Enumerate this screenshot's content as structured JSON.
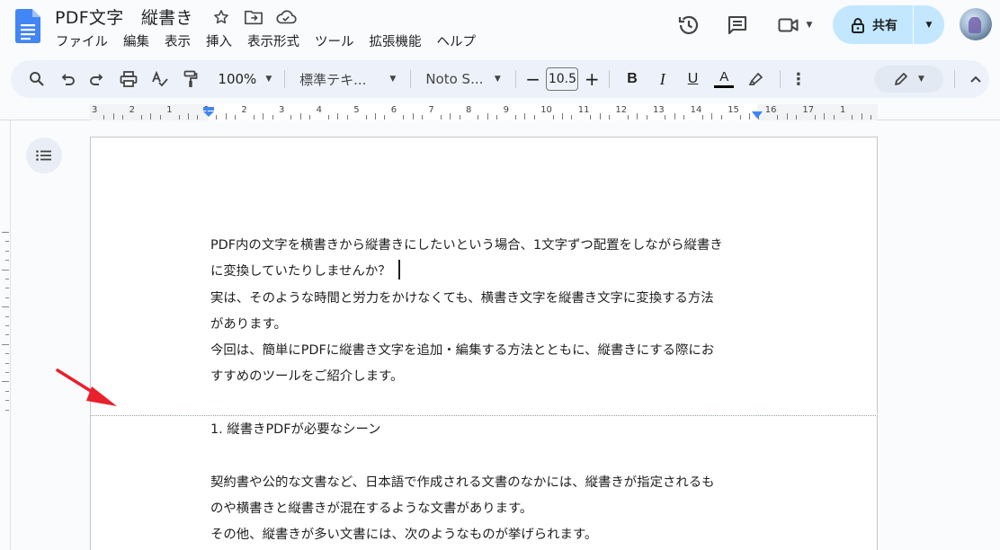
{
  "app": {
    "title": "PDF文字　縦書き",
    "menu": [
      "ファイル",
      "編集",
      "表示",
      "挿入",
      "表示形式",
      "ツール",
      "拡張機能",
      "ヘルプ"
    ],
    "share_label": "共有"
  },
  "toolbar": {
    "zoom": "100%",
    "style": "標準テキ...",
    "font": "Noto S...",
    "font_size": "10.5"
  },
  "ruler": {
    "labels": [
      "3",
      "2",
      "1",
      "1",
      "2",
      "3",
      "4",
      "5",
      "6",
      "7",
      "8",
      "9",
      "10",
      "11",
      "12",
      "13",
      "14",
      "15",
      "16",
      "17",
      "1"
    ]
  },
  "document": {
    "page1_lines": [
      "PDF内の文字を横書きから縦書きにしたいという場合、1文字ずつ配置をしながら縦書き",
      "に変換していたりしませんか？",
      "実は、そのような時間と労力をかけなくても、横書き文字を縦書き文字に変換する方法",
      "があります。",
      "今回は、簡単にPDFに縦書き文字を追加・編集する方法とともに、縦書きにする際にお",
      "すすめのツールをご紹介します。"
    ],
    "page2_lines": [
      "1. 縦書きPDFが必要なシーン",
      "",
      "契約書や公的な文書など、日本語で作成される文書のなかには、縦書きが指定されるも",
      "のや横書きと縦書きが混在するような文書があります。",
      "その他、縦書きが多い文書には、次のようなものが挙げられます。"
    ]
  },
  "colors": {
    "accent": "#0b57d0",
    "share_bg": "#c2e7ff",
    "toolbar_bg": "#edf2fa",
    "arrow": "#e8212d"
  }
}
